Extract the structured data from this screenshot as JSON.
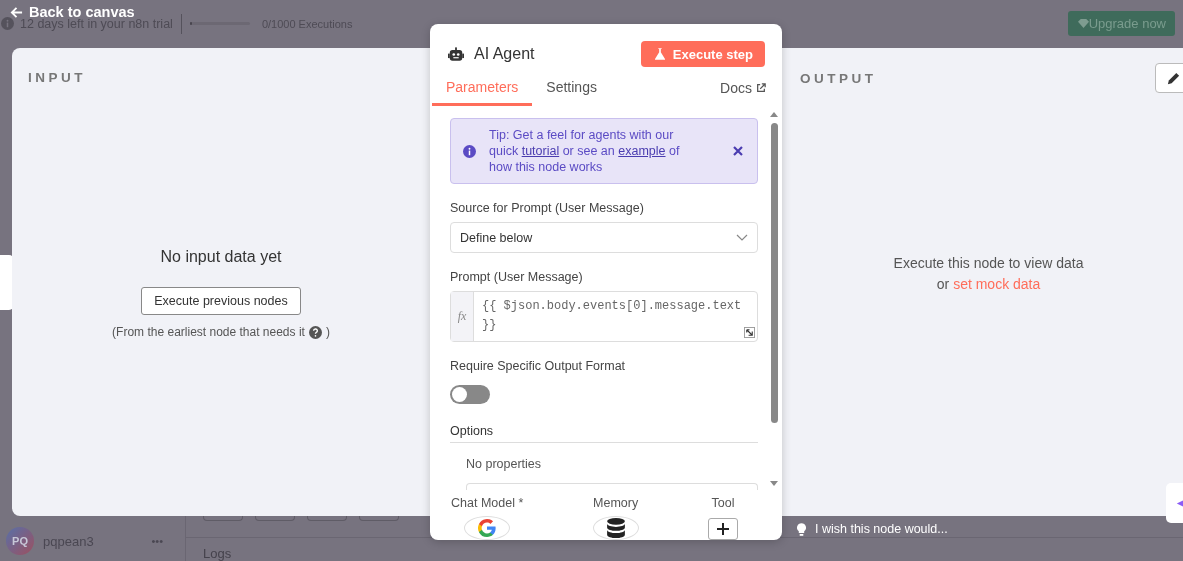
{
  "top_bar": {
    "trial_text": "12 days left in your n8n trial",
    "executions": {
      "level": 0.03,
      "reading": "0/1000 Executions"
    },
    "upgrade_button": "Upgrade now"
  },
  "back_link": "Back to canvas",
  "input_panel": {
    "title": "INPUT",
    "message": "No input data yet",
    "button": "Execute previous nodes",
    "hint": "(From the earliest node that needs it",
    "hint_end": ")"
  },
  "node": {
    "title": "AI Agent",
    "execute_button": "Execute step",
    "tabs": [
      {
        "label": "Parameters",
        "selected": true
      },
      {
        "label": "Settings",
        "selected": false
      }
    ],
    "docs_link": "Docs",
    "tip": {
      "before": "Tip: Get a feel for agents with our quick ",
      "link_1": "tutorial",
      "middle": " or see an ",
      "link_2": "example",
      "after": " of how this node works"
    },
    "source_label": "Source for Prompt (User Message)",
    "source_value": "Define below",
    "prompt_label": "Prompt (User Message)",
    "prompt_prefix": "fx",
    "prompt_value": "{{ $json.body.events[0].message.text }}",
    "format_label": "Require Specific Output Format",
    "format_toggle": {
      "on": false
    },
    "options_label": "Options",
    "options_empty": "No properties",
    "sub_nodes": [
      {
        "label": "Chat Model *",
        "kind": "google"
      },
      {
        "label": "Memory",
        "kind": "database"
      },
      {
        "label": "Tool",
        "kind": "add"
      }
    ]
  },
  "output_panel": {
    "title": "OUTPUT",
    "message": "Execute this node to view data",
    "or_text": "or",
    "mock_link": "set mock data"
  },
  "feedback": "I wish this node would...",
  "user": {
    "initials": "PQ",
    "name": "pqpean3",
    "menu": "•••"
  },
  "logs": "Logs"
}
